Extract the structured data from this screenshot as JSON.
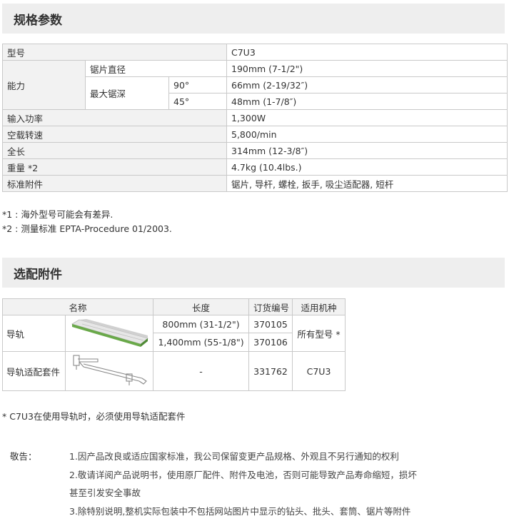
{
  "spec_section": {
    "title": "规格参数",
    "rows": {
      "model": {
        "label": "型号",
        "value": "C7U3"
      },
      "capacity": {
        "label": "能力",
        "blade_diameter": {
          "label": "锯片直径",
          "value": "190mm (7-1/2\")"
        },
        "max_depth": {
          "label": "最大锯深",
          "deg90": {
            "angle": "90°",
            "value": "66mm (2-19/32″)"
          },
          "deg45": {
            "angle": "45°",
            "value": "48mm (1-7/8″)"
          }
        }
      },
      "input_power": {
        "label": "输入功率",
        "value": "1,300W"
      },
      "no_load_speed": {
        "label": "空载转速",
        "value": "5,800/min"
      },
      "length": {
        "label": "全长",
        "value": "314mm (12-3/8″)"
      },
      "weight": {
        "label": "重量 *2",
        "value": "4.7kg (10.4lbs.)"
      },
      "accessories": {
        "label": "标准附件",
        "value": "锯片, 导杆, 螺栓, 扳手, 吸尘适配器, 短杆"
      }
    },
    "notes": [
      "*1 : 海外型号可能会有差异.",
      "*2 : 测量标准 EPTA-Procedure 01/2003."
    ]
  },
  "accessory_section": {
    "title": "选配附件",
    "headers": {
      "name": "名称",
      "length": "长度",
      "order_no": "订货编号",
      "applicable": "适用机种"
    },
    "rows": {
      "guide_rail": {
        "name": "导轨",
        "variants": [
          {
            "length": "800mm (31-1/2\")",
            "order_no": "370105"
          },
          {
            "length": "1,400mm (55-1/8\")",
            "order_no": "370106"
          }
        ],
        "applicable": "所有型号 *"
      },
      "adapter": {
        "name": "导轨适配套件",
        "length": "-",
        "order_no": "331762",
        "applicable": "C7U3"
      }
    },
    "note": "* C7U3在使用导轨时，必须使用导轨适配套件"
  },
  "warning": {
    "label": "敬告：",
    "lines": [
      "1.因产品改良或适应国家标准，我公司保留变更产品规格、外观且不另行通知的权利",
      "2.敬请详阅产品说明书，使用原厂配件、附件及电池，否则可能导致产品寿命缩短，损坏",
      "甚至引发安全事故",
      "3.除特别说明,整机实际包装中不包括网站图片中显示的钻头、批头、套筒、锯片等附件"
    ]
  },
  "colors": {
    "header_bg": "#eeeeee",
    "label_bg": "#f2f2f2",
    "border": "#c9c9c9",
    "rail_green": "#6aa94a"
  }
}
